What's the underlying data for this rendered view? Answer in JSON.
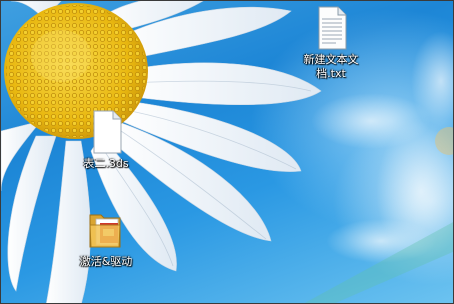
{
  "desktop": {
    "icons": [
      {
        "label": "新建文本文档.txt",
        "icon": "text-document-icon"
      },
      {
        "label": "表二.3ds",
        "icon": "blank-file-icon"
      },
      {
        "label": "激活&驱动",
        "icon": "folder-icon"
      }
    ]
  },
  "colors": {
    "sky": "#1d86d6",
    "petal": "#f2f6fa",
    "flower_center": "#f2c418"
  }
}
